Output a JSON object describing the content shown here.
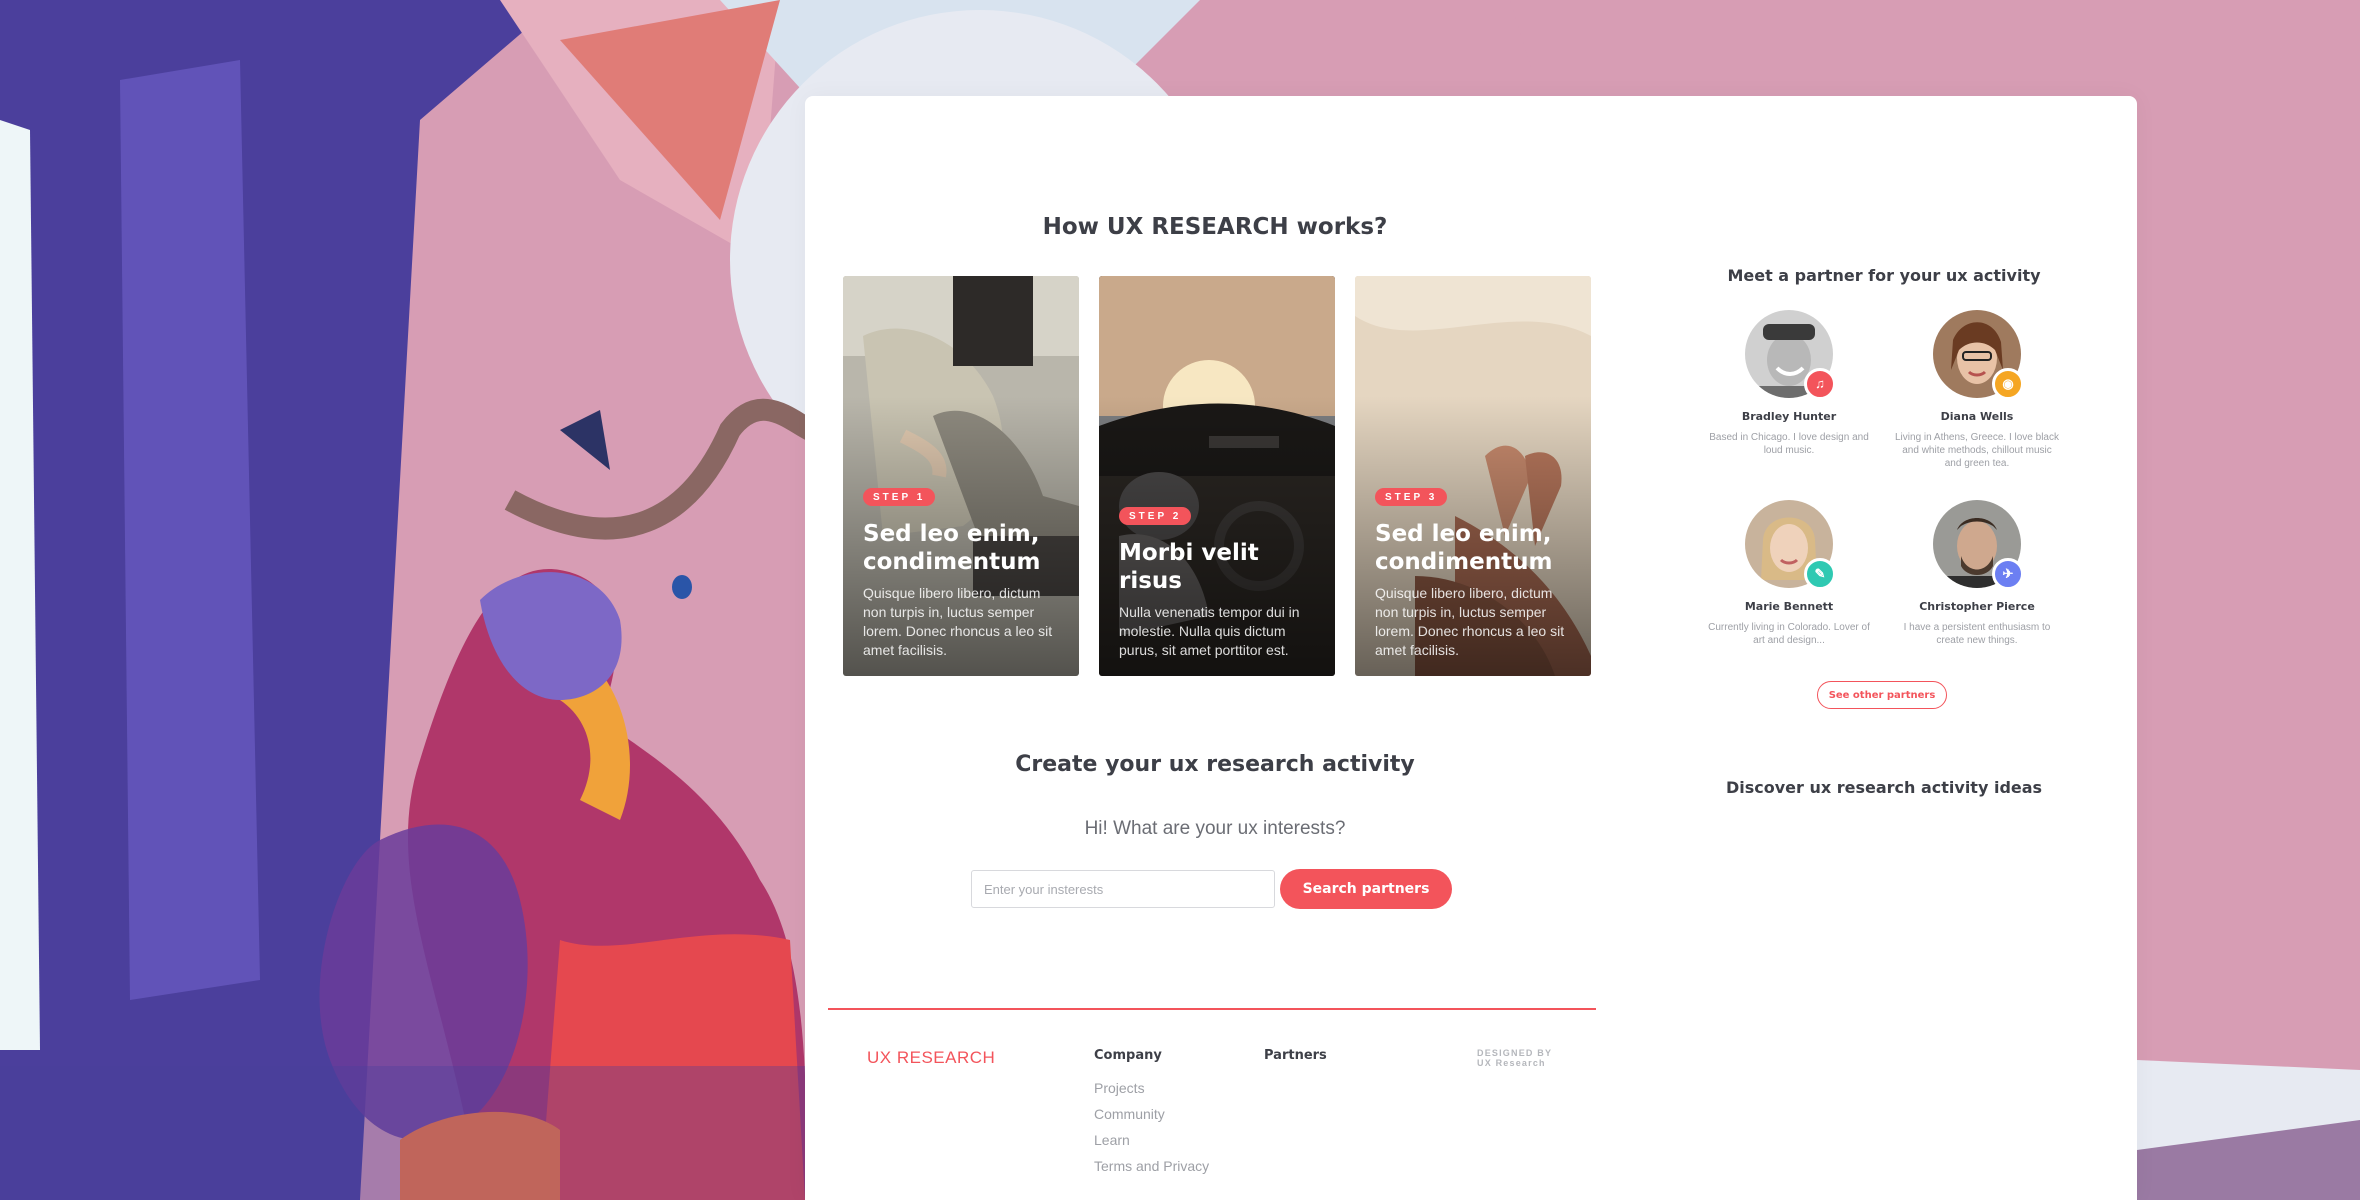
{
  "how": {
    "title": "How UX RESEARCH works?",
    "steps": [
      {
        "badge": "STEP 1",
        "title": "Sed leo enim, condimentum",
        "text": "Quisque libero libero, dictum non turpis in, luctus semper lorem. Donec rhoncus a leo sit amet facilisis."
      },
      {
        "badge": "STEP 2",
        "title": "Morbi velit risus",
        "text": "Nulla venenatis tempor dui in molestie. Nulla quis dictum purus, sit amet porttitor est."
      },
      {
        "badge": "STEP 3",
        "title": "Sed leo enim, condimentum",
        "text": "Quisque libero libero, dictum non turpis in, luctus semper lorem. Donec rhoncus a leo sit amet facilisis."
      }
    ]
  },
  "create": {
    "title": "Create your ux research activity",
    "question": "Hi! What are your ux interests?",
    "input_placeholder": "Enter your insterests",
    "input_value": "",
    "button_label": "Search partners"
  },
  "footer": {
    "brand": "UX RESEARCH",
    "company_title": "Company",
    "company_links": [
      "Projects",
      "Community",
      "Learn",
      "Terms and Privacy"
    ],
    "partners_title": "Partners",
    "designed_by_label": "DESIGNED BY",
    "designed_by_name": "UX Research"
  },
  "sidebar": {
    "partners_title": "Meet a partner for your ux activity",
    "partners": [
      {
        "name": "Bradley Hunter",
        "bio": "Based in Chicago. I love design and loud music.",
        "badge_icon": "music-note-icon",
        "badge_color": "#f3545b"
      },
      {
        "name": "Diana Wells",
        "bio": "Living in Athens, Greece. I love black and white methods, chillout music and green tea.",
        "badge_icon": "camera-icon",
        "badge_color": "#f5a623"
      },
      {
        "name": "Marie Bennett",
        "bio": "Currently living in Colorado. Lover of art and design...",
        "badge_icon": "pencil-icon",
        "badge_color": "#2fc9b2"
      },
      {
        "name": "Christopher Pierce",
        "bio": "I have a persistent enthusiasm to create new things.",
        "badge_icon": "airplane-icon",
        "badge_color": "#6c7ff2"
      }
    ],
    "see_other_label": "See other partners",
    "discover_title": "Discover ux research activity ideas"
  },
  "colors": {
    "accent": "#f3545b",
    "text_dark": "#3d3f47",
    "text_muted": "#9ea0a6",
    "background_pink": "#d79db4",
    "background_purple": "#4b3f9c"
  }
}
